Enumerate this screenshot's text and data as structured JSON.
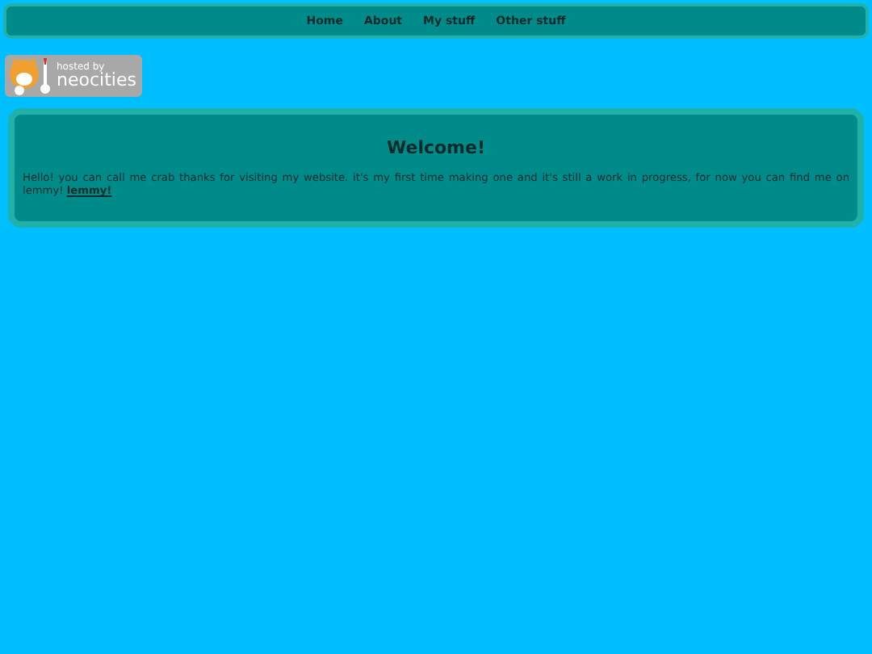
{
  "nav": {
    "links": [
      "Home",
      "About",
      "My stuff",
      "Other stuff"
    ]
  },
  "badge": {
    "small": "hosted by",
    "big": "neocities"
  },
  "card": {
    "title": "Welcome!",
    "text": "Hello! you can call me crab thanks for visiting my website. it's my first time making one and it's still a work in progress, for now you can find me on lemmy!",
    "link": "lemmy!"
  }
}
